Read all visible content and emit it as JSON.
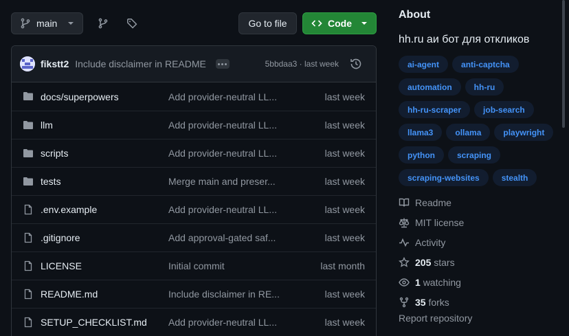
{
  "toolbar": {
    "branch_label": "main",
    "goto_label": "Go to file",
    "code_label": "Code"
  },
  "commit": {
    "author": "fikstt2",
    "message": "Include disclaimer in README",
    "meta": "5bbdaa3 · last week"
  },
  "files": [
    {
      "name": "docs/superpowers",
      "type": "folder",
      "commit": "Add provider-neutral LL...",
      "time": "last week"
    },
    {
      "name": "llm",
      "type": "folder",
      "commit": "Add provider-neutral LL...",
      "time": "last week"
    },
    {
      "name": "scripts",
      "type": "folder",
      "commit": "Add provider-neutral LL...",
      "time": "last week"
    },
    {
      "name": "tests",
      "type": "folder",
      "commit": "Merge main and preser...",
      "time": "last week"
    },
    {
      "name": ".env.example",
      "type": "file",
      "commit": "Add provider-neutral LL...",
      "time": "last week"
    },
    {
      "name": ".gitignore",
      "type": "file",
      "commit": "Add approval-gated saf...",
      "time": "last week"
    },
    {
      "name": "LICENSE",
      "type": "file",
      "commit": "Initial commit",
      "time": "last month"
    },
    {
      "name": "README.md",
      "type": "file",
      "commit": "Include disclaimer in RE...",
      "time": "last week"
    },
    {
      "name": "SETUP_CHECKLIST.md",
      "type": "file",
      "commit": "Add provider-neutral LL...",
      "time": "last week"
    }
  ],
  "about": {
    "title": "About",
    "description": "hh.ru аи бот для откликов",
    "topics": [
      "ai-agent",
      "anti-captcha",
      "automation",
      "hh-ru",
      "hh-ru-scraper",
      "job-search",
      "llama3",
      "ollama",
      "playwright",
      "python",
      "scraping",
      "scraping-websites",
      "stealth"
    ],
    "readme": "Readme",
    "license": "MIT license",
    "activity": "Activity",
    "stars_count": "205",
    "stars_label": "stars",
    "watching_count": "1",
    "watching_label": "watching",
    "forks_count": "35",
    "forks_label": "forks",
    "report": "Report repository"
  },
  "colors": {
    "background": "#0d1117",
    "code_button": "#238636",
    "topic_text": "#4493f8",
    "topic_bg": "#121d2f",
    "muted_text": "#9198a1"
  }
}
